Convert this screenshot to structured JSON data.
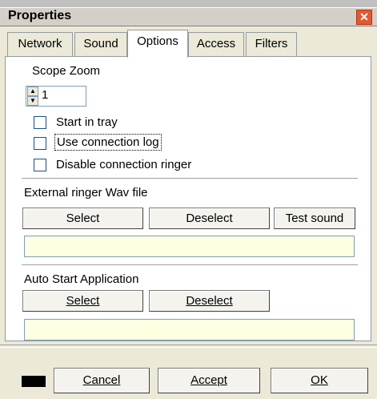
{
  "window": {
    "title": "Properties",
    "close_glyph": "✕"
  },
  "tabs": [
    {
      "label": "Network",
      "active": false
    },
    {
      "label": "Sound",
      "active": false
    },
    {
      "label": "Options",
      "active": true
    },
    {
      "label": "Access",
      "active": false
    },
    {
      "label": "Filters",
      "active": false
    }
  ],
  "options": {
    "scope_zoom": {
      "label": "Scope Zoom",
      "value": "1"
    },
    "checkboxes": [
      {
        "label": "Start in tray",
        "checked": false
      },
      {
        "label": "Use connection log",
        "checked": false
      },
      {
        "label": "Disable connection ringer",
        "checked": false
      }
    ],
    "ringer": {
      "label": "External ringer Wav file",
      "select_label": "Select",
      "deselect_label": "Deselect",
      "test_label": "Test sound",
      "path_value": ""
    },
    "autostart": {
      "label": "Auto Start Application",
      "select_label": "Select",
      "deselect_label": "Deselect",
      "path_value": ""
    }
  },
  "footer": {
    "color_swatch": "#000000",
    "cancel_label": "Cancel",
    "accept_label": "Accept",
    "ok_label": "OK"
  }
}
